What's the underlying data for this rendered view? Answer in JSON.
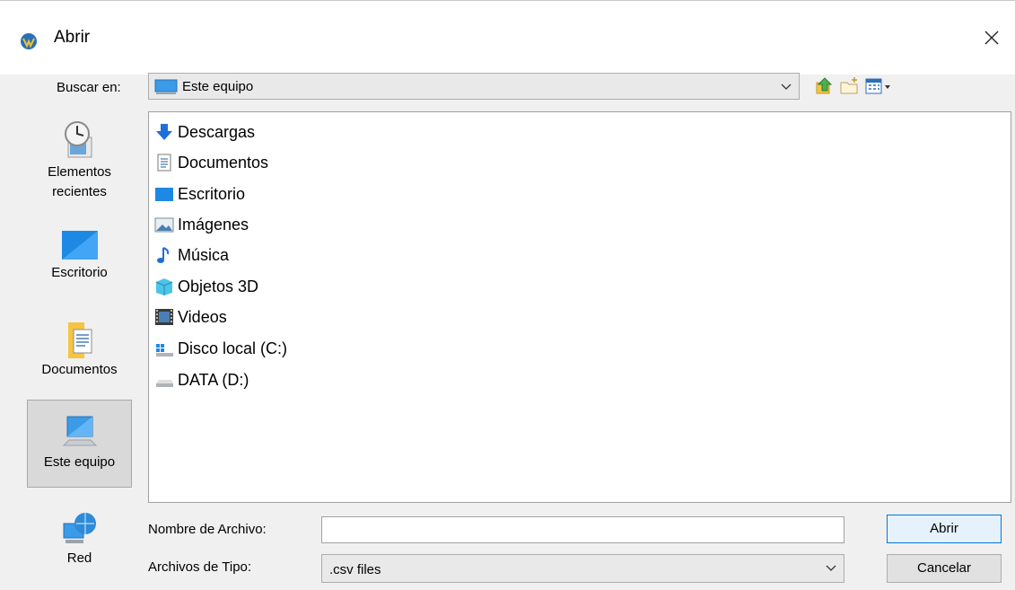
{
  "window": {
    "title": "Abrir",
    "close_icon": "close-icon"
  },
  "lookin": {
    "label": "Buscar en:",
    "value": "Este equipo",
    "icon": "computer-icon"
  },
  "toolbar": {
    "up_icon": "up-folder-icon",
    "new_folder_icon": "new-folder-icon",
    "view_icon": "view-menu-icon"
  },
  "places": [
    {
      "label_line1": "Elementos",
      "label_line2": "recientes",
      "icon": "recent-items-icon"
    },
    {
      "label_line1": "Escritorio",
      "label_line2": "",
      "icon": "desktop-icon"
    },
    {
      "label_line1": "Documentos",
      "label_line2": "",
      "icon": "documents-icon"
    },
    {
      "label_line1": "Este equipo",
      "label_line2": "",
      "icon": "computer-icon",
      "selected": true
    },
    {
      "label_line1": "Red",
      "label_line2": "",
      "icon": "network-icon"
    }
  ],
  "files": [
    {
      "name": "Descargas",
      "icon": "downloads-icon"
    },
    {
      "name": "Documentos",
      "icon": "documents-icon"
    },
    {
      "name": "Escritorio",
      "icon": "desktop-icon"
    },
    {
      "name": "Imágenes",
      "icon": "pictures-icon"
    },
    {
      "name": "Música",
      "icon": "music-icon"
    },
    {
      "name": "Objetos 3D",
      "icon": "3d-objects-icon"
    },
    {
      "name": "Videos",
      "icon": "videos-icon"
    },
    {
      "name": "Disco local (C:)",
      "icon": "local-disk-icon"
    },
    {
      "name": "DATA (D:)",
      "icon": "drive-icon"
    }
  ],
  "filename": {
    "label": "Nombre de Archivo:",
    "value": ""
  },
  "filetype": {
    "label": "Archivos de Tipo:",
    "value": ".csv files"
  },
  "buttons": {
    "open": "Abrir",
    "cancel": "Cancelar"
  },
  "colors": {
    "accent": "#0078d7",
    "selected_bg": "#d9d9d9"
  }
}
